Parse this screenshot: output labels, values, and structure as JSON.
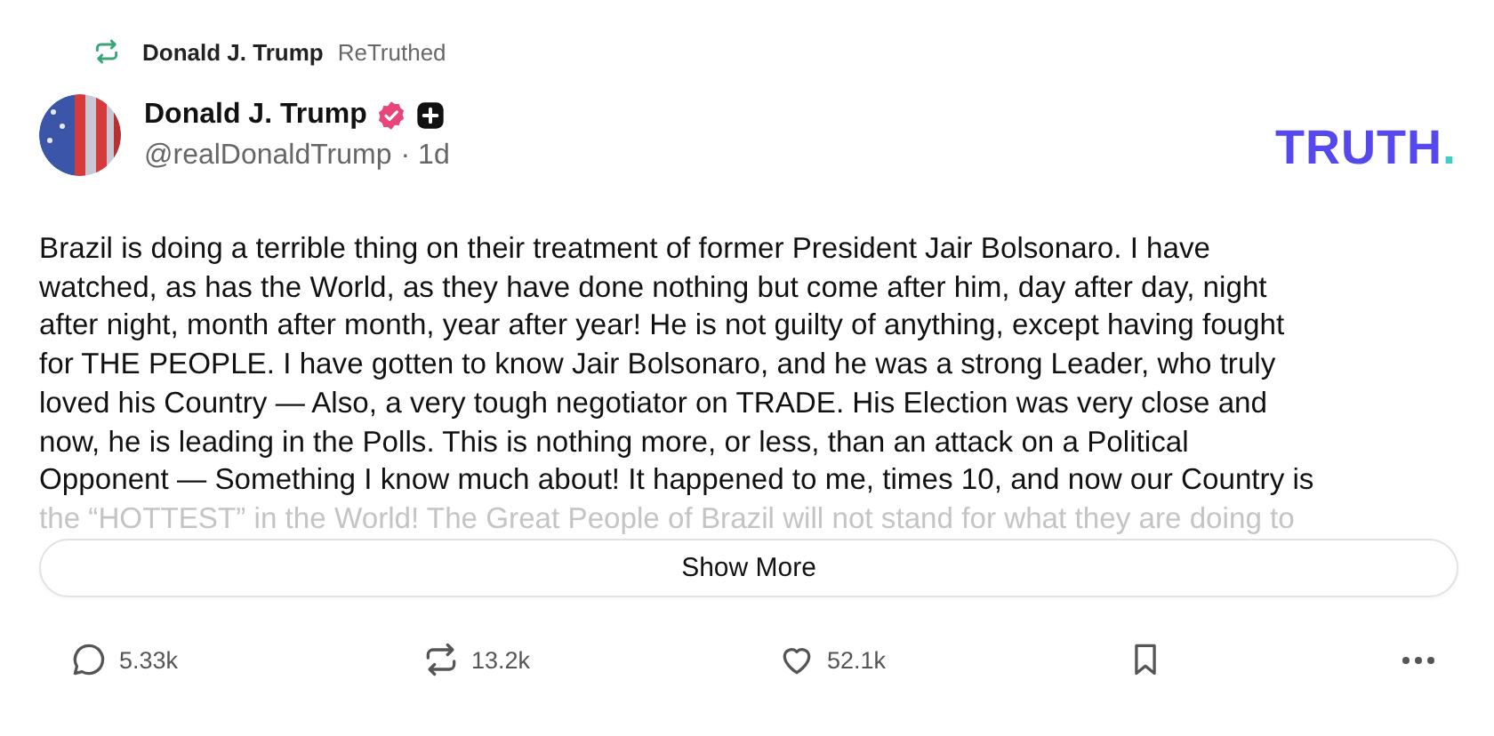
{
  "repost": {
    "name": "Donald J. Trump",
    "action": "ReTruthed"
  },
  "author": {
    "name": "Donald J. Trump",
    "verified": true,
    "handle": "@realDonaldTrump",
    "time": "· 1d"
  },
  "logo": {
    "word": "TRUTH",
    "dot": "."
  },
  "body_lines": [
    "Brazil is doing a terrible thing on their treatment of former President Jair Bolsonaro. I have",
    "watched, as has the World, as they have done nothing but come after him, day after day, night",
    "after night, month after month, year after year! He is not guilty of anything, except having fought",
    "for THE PEOPLE. I have gotten to know Jair Bolsonaro, and he was a strong Leader, who truly",
    "loved his Country — Also, a very tough negotiator on TRADE. His Election was very close and",
    "now, he is leading in the Polls. This is nothing more, or less, than an attack on a Political",
    "Opponent — Something I know much about! It happened to me, times 10, and now our Country is",
    "the “HOTTEST” in the World! The Great People of Brazil will not stand for what they are doing to"
  ],
  "show_more": "Show More",
  "actions": [
    {
      "kind": "reply",
      "count": "5.33k"
    },
    {
      "kind": "retruth",
      "count": "13.2k"
    },
    {
      "kind": "like",
      "count": "52.1k"
    },
    {
      "kind": "bookmark"
    },
    {
      "kind": "more"
    }
  ]
}
